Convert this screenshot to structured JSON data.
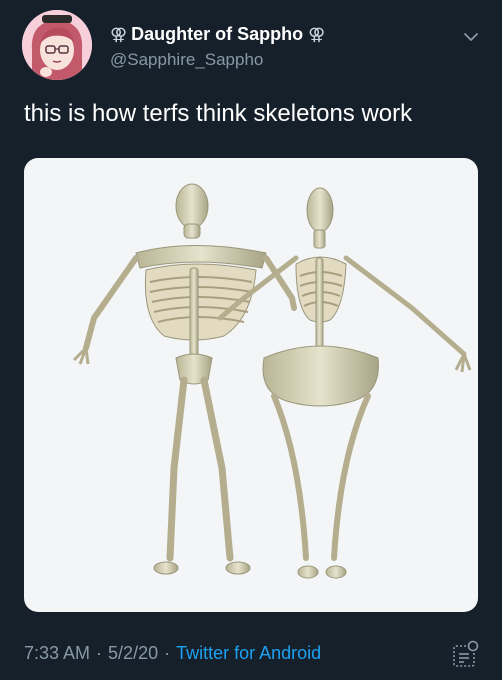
{
  "user": {
    "display_name": "Daughter of Sappho",
    "name_decoration_left": "⚢",
    "name_decoration_right": "⚢",
    "handle": "@Sapphire_Sappho"
  },
  "tweet": {
    "text": "this is how terfs think skeletons work",
    "time": "7:33 AM",
    "separator": "·",
    "date": "5/2/20",
    "source": "Twitter for Android"
  },
  "icons": {
    "menu": "chevron-down-icon",
    "analytics": "analytics-icon"
  },
  "colors": {
    "background": "#15202b",
    "text": "#ffffff",
    "secondary": "#8899a6",
    "link": "#1da1f2"
  }
}
